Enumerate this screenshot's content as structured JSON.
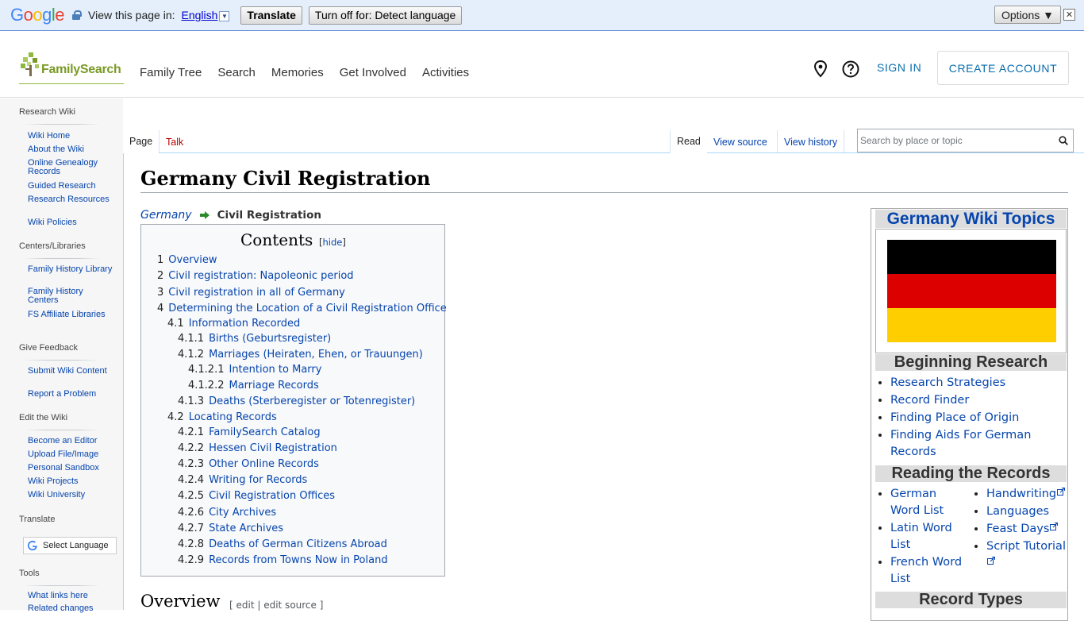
{
  "gtranslate": {
    "logo": [
      "G",
      "o",
      "o",
      "g",
      "l",
      "e"
    ],
    "view_label": "View this page in:",
    "language": "English",
    "translate_button": "Translate",
    "turn_off_button": "Turn off for: Detect language",
    "options_button": "Options ▼",
    "close_glyph": "✕"
  },
  "header": {
    "logo_text": "FamilySearch",
    "nav": [
      "Family Tree",
      "Search",
      "Memories",
      "Get Involved",
      "Activities"
    ],
    "sign_in": "SIGN IN",
    "create_account": "CREATE ACCOUNT"
  },
  "sidebar": {
    "sections": [
      {
        "heading": "Research Wiki",
        "links": [
          "Wiki Home",
          "About the Wiki",
          "Online Genealogy Records",
          "Guided Research",
          "Research Resources",
          "Wiki Policies"
        ]
      },
      {
        "heading": "Centers/Libraries",
        "links": [
          "Family History Library",
          "Family History Centers",
          "FS Affiliate Libraries"
        ]
      },
      {
        "heading": "Give Feedback",
        "links": [
          "Submit Wiki Content",
          "Report a Problem"
        ]
      },
      {
        "heading": "Edit the Wiki",
        "links": [
          "Become an Editor",
          "Upload File/Image",
          "Personal Sandbox",
          "Wiki Projects",
          "Wiki University"
        ]
      },
      {
        "heading": "Translate",
        "links": []
      },
      {
        "heading": "Tools",
        "links": [
          "What links here",
          "Related changes"
        ]
      }
    ],
    "select_language": "Select Language"
  },
  "tabs": {
    "page": "Page",
    "talk": "Talk",
    "read": "Read",
    "view_source": "View source",
    "view_history": "View history",
    "search_placeholder": "Search by place or topic"
  },
  "article": {
    "title": "Germany Civil Registration",
    "breadcrumb_parent": "Germany",
    "breadcrumb_current": "Civil Registration",
    "toc_title": "Contents",
    "toc_hide": "hide",
    "toc": [
      {
        "num": "1",
        "text": "Overview",
        "level": 1
      },
      {
        "num": "2",
        "text": "Civil registration: Napoleonic period",
        "level": 1
      },
      {
        "num": "3",
        "text": "Civil registration in all of Germany",
        "level": 1
      },
      {
        "num": "4",
        "text": "Determining the Location of a Civil Registration Office",
        "level": 1
      },
      {
        "num": "4.1",
        "text": "Information Recorded",
        "level": 2
      },
      {
        "num": "4.1.1",
        "text": "Births (Geburtsregister)",
        "level": 3
      },
      {
        "num": "4.1.2",
        "text": "Marriages (Heiraten, Ehen, or Trauungen)",
        "level": 3
      },
      {
        "num": "4.1.2.1",
        "text": "Intention to Marry",
        "level": 4
      },
      {
        "num": "4.1.2.2",
        "text": "Marriage Records",
        "level": 4
      },
      {
        "num": "4.1.3",
        "text": "Deaths (Sterberegister or Totenregister)",
        "level": 3
      },
      {
        "num": "4.2",
        "text": "Locating Records",
        "level": 2
      },
      {
        "num": "4.2.1",
        "text": "FamilySearch Catalog",
        "level": 3
      },
      {
        "num": "4.2.2",
        "text": "Hessen Civil Registration",
        "level": 3
      },
      {
        "num": "4.2.3",
        "text": "Other Online Records",
        "level": 3
      },
      {
        "num": "4.2.4",
        "text": "Writing for Records",
        "level": 3
      },
      {
        "num": "4.2.5",
        "text": "Civil Registration Offices",
        "level": 3
      },
      {
        "num": "4.2.6",
        "text": "City Archives",
        "level": 3
      },
      {
        "num": "4.2.7",
        "text": "State Archives",
        "level": 3
      },
      {
        "num": "4.2.8",
        "text": "Deaths of German Citizens Abroad",
        "level": 3
      },
      {
        "num": "4.2.9",
        "text": "Records from Towns Now in Poland",
        "level": 3
      }
    ],
    "overview_heading": "Overview",
    "edit_links": "[ edit | edit source ]"
  },
  "infobox": {
    "title": "Germany Wiki Topics",
    "flag_colors": [
      "#000000",
      "#dd0000",
      "#ffce00"
    ],
    "beginning_research": "Beginning Research",
    "beginning_links": [
      "Research Strategies",
      "Record Finder",
      "Finding Place of Origin",
      "Finding Aids For German Records"
    ],
    "reading_records": "Reading the Records",
    "reading_left": [
      "German Word List",
      "Latin Word List",
      "French Word List"
    ],
    "reading_right": [
      "Handwriting",
      "Languages",
      "Feast Days",
      "Script Tutorial"
    ],
    "record_types": "Record Types"
  }
}
